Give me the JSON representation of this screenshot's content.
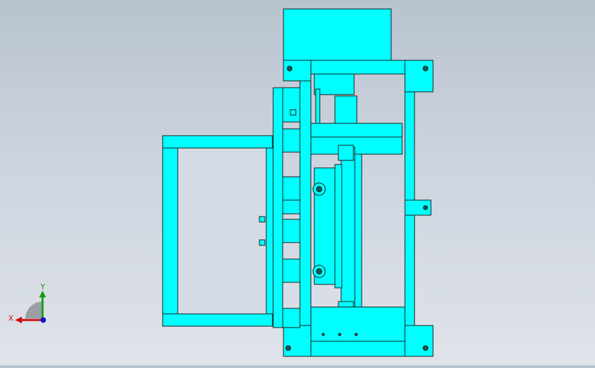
{
  "viewport": {
    "model_color": "#00ffff",
    "edge_color": "#1a1a1a",
    "background_top": "#b8c3d0",
    "background_bottom": "#dfe3ea"
  },
  "triad": {
    "x_label": "X",
    "y_label": "Y",
    "x_color": "#d01010",
    "y_color": "#10a010",
    "z_color": "#1010d0"
  }
}
